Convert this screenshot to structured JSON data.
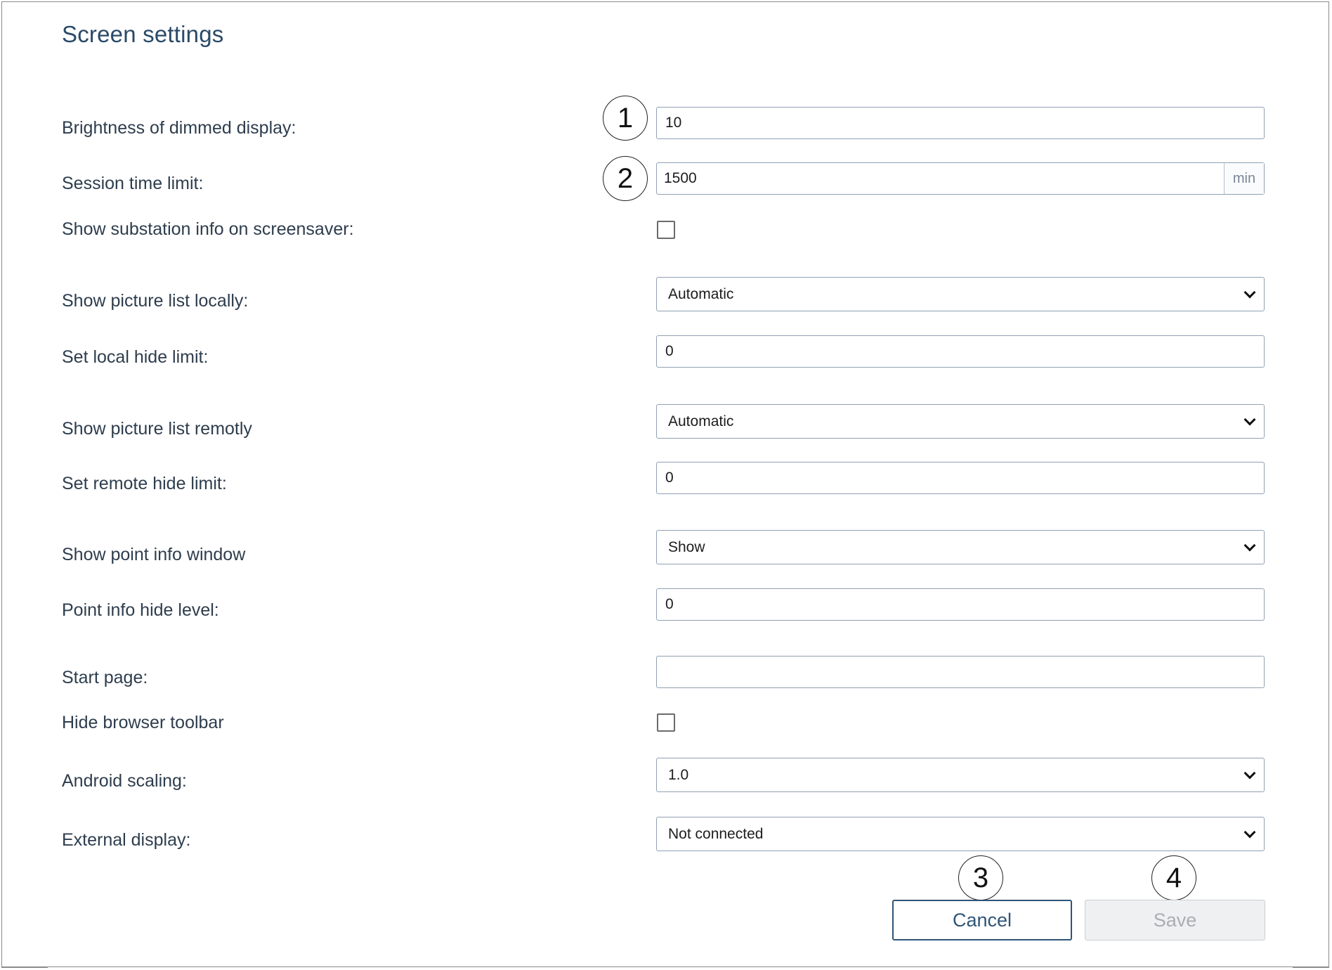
{
  "page": {
    "title": "Screen settings"
  },
  "form": {
    "brightness": {
      "label": "Brightness of dimmed display:",
      "value": "10",
      "callout": "1"
    },
    "session_time": {
      "label": "Session time limit:",
      "value": "1500",
      "unit": "min",
      "callout": "2"
    },
    "substation_info": {
      "label": "Show substation info on screensaver:",
      "checked": false
    },
    "picture_list_local": {
      "label": "Show picture list locally:",
      "selected": "Automatic"
    },
    "local_hide_limit": {
      "label": "Set local hide limit:",
      "value": "0"
    },
    "picture_list_remote": {
      "label": "Show picture list remotly",
      "selected": "Automatic"
    },
    "remote_hide_limit": {
      "label": "Set remote hide limit:",
      "value": "0"
    },
    "point_info_window": {
      "label": "Show point info window",
      "selected": "Show"
    },
    "point_info_hide_level": {
      "label": "Point info hide level:",
      "value": "0"
    },
    "start_page": {
      "label": "Start page:",
      "value": ""
    },
    "hide_browser_toolbar": {
      "label": "Hide browser toolbar",
      "checked": false
    },
    "android_scaling": {
      "label": "Android scaling:",
      "selected": "1.0"
    },
    "external_display": {
      "label": "External display:",
      "selected": "Not connected"
    }
  },
  "actions": {
    "cancel_label": "Cancel",
    "cancel_callout": "3",
    "save_label": "Save",
    "save_callout": "4"
  }
}
